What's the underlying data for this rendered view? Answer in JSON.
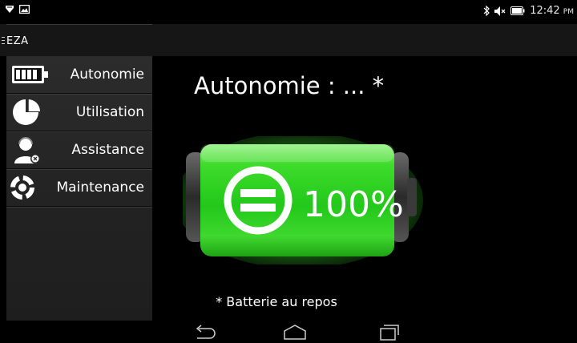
{
  "status_bar": {
    "icons_left": [
      "shield-notification-icon",
      "image-notification-icon"
    ],
    "icons_right": [
      "bluetooth-icon",
      "mute-icon",
      "battery-icon"
    ],
    "time": "12:42",
    "meridiem": "PM"
  },
  "app": {
    "title": "EZA"
  },
  "sidebar": {
    "items": [
      {
        "label": "Autonomie",
        "icon": "battery-icon"
      },
      {
        "label": "Utilisation",
        "icon": "pie-chart-icon"
      },
      {
        "label": "Assistance",
        "icon": "support-agent-icon"
      },
      {
        "label": "Maintenance",
        "icon": "maintenance-cycle-icon"
      }
    ]
  },
  "main": {
    "title": "Autonomie : ... *",
    "battery_percent": "100%",
    "battery_level": 1.0,
    "footnote": "* Batterie au repos"
  },
  "colors": {
    "battery_green": "#3fdc2c",
    "sidebar_bg": "#2a2a2a",
    "background": "#000000"
  },
  "nav_bar": {
    "buttons": [
      "back-icon",
      "home-icon",
      "recents-icon"
    ]
  }
}
